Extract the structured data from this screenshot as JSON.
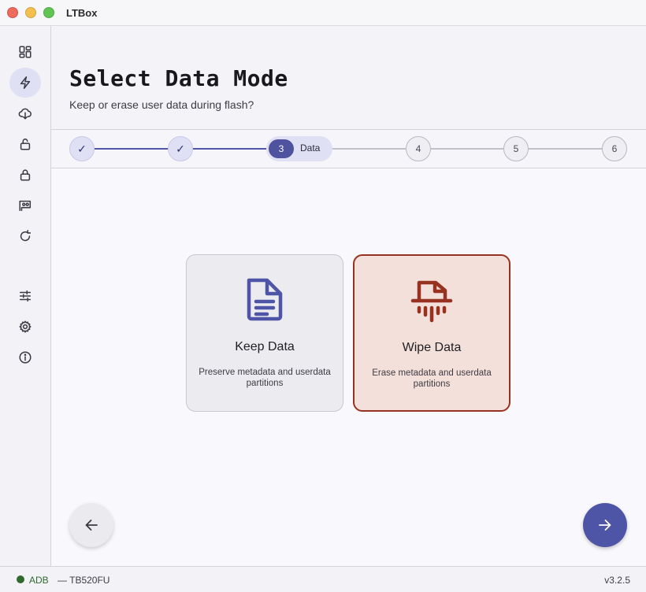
{
  "window": {
    "title": "LTBox"
  },
  "sidebar": {
    "items": [
      {
        "icon": "dashboard-icon",
        "active": false
      },
      {
        "icon": "flash-icon",
        "active": true
      },
      {
        "icon": "cloud-download-icon",
        "active": false
      },
      {
        "icon": "lock-open-icon",
        "active": false
      },
      {
        "icon": "lock-icon",
        "active": false
      },
      {
        "icon": "chip-icon",
        "active": false
      },
      {
        "icon": "refresh-icon",
        "active": false
      },
      {
        "icon": "sliders-icon",
        "active": false
      },
      {
        "icon": "gear-icon",
        "active": false
      },
      {
        "icon": "info-icon",
        "active": false
      }
    ]
  },
  "header": {
    "title": "Select Data Mode",
    "subtitle": "Keep or erase user data during flash?"
  },
  "stepper": {
    "steps": [
      {
        "label": "✓",
        "state": "done"
      },
      {
        "label": "✓",
        "state": "done"
      },
      {
        "label": "3",
        "name": "Data",
        "state": "active"
      },
      {
        "label": "4",
        "state": "todo"
      },
      {
        "label": "5",
        "state": "todo"
      },
      {
        "label": "6",
        "state": "todo"
      }
    ]
  },
  "options": {
    "keep": {
      "title": "Keep Data",
      "description": "Preserve metadata and userdata partitions",
      "icon": "document-icon",
      "selected": false
    },
    "wipe": {
      "title": "Wipe Data",
      "description": "Erase metadata and userdata partitions",
      "icon": "shredder-icon",
      "selected": true
    }
  },
  "navigation": {
    "back_icon": "arrow-left-icon",
    "next_icon": "arrow-right-icon"
  },
  "status": {
    "connection": "ADB",
    "device": "— TB520FU",
    "version": "v3.2.5",
    "connection_color": "#2f6a2f"
  },
  "colors": {
    "accent": "#4f55a6",
    "danger": "#96321f",
    "danger_bg": "#f4e0da"
  }
}
